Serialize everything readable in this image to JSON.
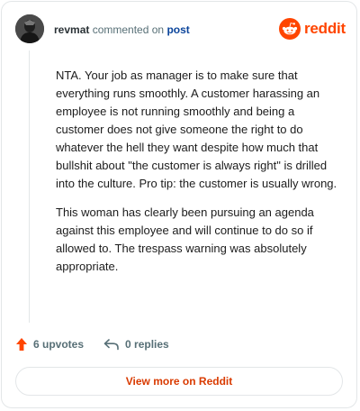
{
  "header": {
    "username": "revmat",
    "commented_text": "commented on",
    "post_link": "post"
  },
  "brand": {
    "name": "reddit",
    "icon": "reddit-snoo-icon",
    "color": "#ff4500"
  },
  "comment": {
    "paragraphs": [
      "NTA. Your job as manager is to make sure that everything runs smoothly. A customer harassing an employee is not running smoothly and being a customer does not give someone the right to do whatever the hell they want despite how much that bullshit about \"the customer is always right\" is drilled into the culture. Pro tip: the customer is usually wrong.",
      "This woman has clearly been pursuing an agenda against this employee and will continue to do so if allowed to. The trespass warning was absolutely appropriate."
    ]
  },
  "actions": {
    "upvotes_label": "6 upvotes",
    "upvote_icon": "upvote-arrow-icon",
    "upvote_color": "#ff4500",
    "replies_label": "0 replies",
    "reply_icon": "reply-arrow-icon"
  },
  "footer": {
    "view_more_label": "View more on Reddit",
    "link_color": "#d93a00"
  }
}
